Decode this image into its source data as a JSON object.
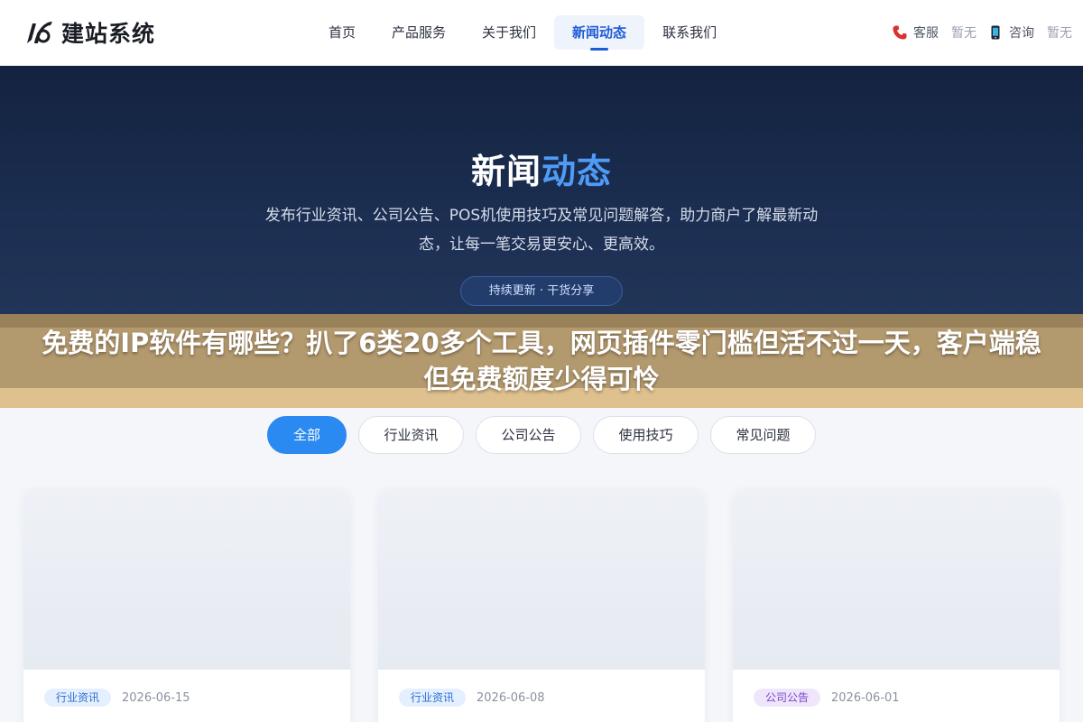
{
  "header": {
    "logo_text": "建站系统",
    "nav": [
      {
        "label": "首页",
        "active": false
      },
      {
        "label": "产品服务",
        "active": false
      },
      {
        "label": "关于我们",
        "active": false
      },
      {
        "label": "新闻动态",
        "active": true
      },
      {
        "label": "联系我们",
        "active": false
      }
    ],
    "contacts": [
      {
        "icon": "phone-icon",
        "label": "客服",
        "value": "暂无"
      },
      {
        "icon": "mobile-icon",
        "label": "咨询",
        "value": "暂无"
      }
    ]
  },
  "hero": {
    "title_main": "新闻",
    "title_highlight": "动态",
    "description": "发布行业资讯、公司公告、POS机使用技巧及常见问题解答，助力商户了解最新动态，让每一笔交易更安心、更高效。",
    "badge": "持续更新 · 干货分享"
  },
  "banner": {
    "text": "免费的IP软件有哪些？扒了6类20多个工具，网页插件零门槛但活不过一天，客户端稳但免费额度少得可怜"
  },
  "tabs": [
    {
      "label": "全部",
      "active": true
    },
    {
      "label": "行业资讯",
      "active": false
    },
    {
      "label": "公司公告",
      "active": false
    },
    {
      "label": "使用技巧",
      "active": false
    },
    {
      "label": "常见问题",
      "active": false
    }
  ],
  "cards": [
    {
      "tag": "行业资讯",
      "date": "2026-06-15",
      "title": ""
    },
    {
      "tag": "行业资讯",
      "date": "2026-06-08",
      "title": ""
    },
    {
      "tag": "公司公告",
      "date": "2026-06-01",
      "title": ""
    }
  ],
  "colors": {
    "accent": "#2b8af2",
    "nav_active": "#1f5bd6",
    "hero_bg": "#1a2b4c",
    "hero_highlight": "#4f9bf5",
    "banner": "#aa8c5a"
  }
}
